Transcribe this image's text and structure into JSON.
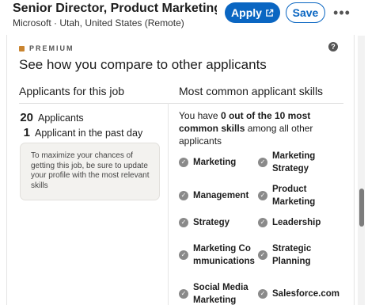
{
  "job": {
    "title": "Senior Director, Product Marketing, Market...",
    "meta": "Microsoft · Utah, United States (Remote)"
  },
  "actions": {
    "apply_label": "Apply",
    "save_label": "Save",
    "more_label": "•••"
  },
  "premium": {
    "label": "PREMIUM",
    "help_glyph": "?",
    "title": "See how you compare to other applicants"
  },
  "applicants": {
    "heading": "Applicants for this job",
    "total_count": "20",
    "total_label": "Applicants",
    "recent_count": "1",
    "recent_label": "Applicant in the past day",
    "tip": "To maximize your chances of getting this job, be sure to update your profile with the most relevant skills"
  },
  "skills": {
    "heading": "Most common applicant skills",
    "compare_prefix": "You have ",
    "compare_bold": "0 out of the 10 most common skills",
    "compare_suffix": " among all other applicants",
    "items": [
      "Marketing",
      "Marketing Strategy",
      "Management",
      "Product Marketing",
      "Strategy",
      "Leadership",
      "Marketing Communications",
      "Strategic Planning",
      "Social Media Marketing",
      "Salesforce.com"
    ]
  },
  "colors": {
    "primary": "#0a66c2",
    "premium_accent": "#c9842f",
    "check": "#8a8a8a"
  }
}
